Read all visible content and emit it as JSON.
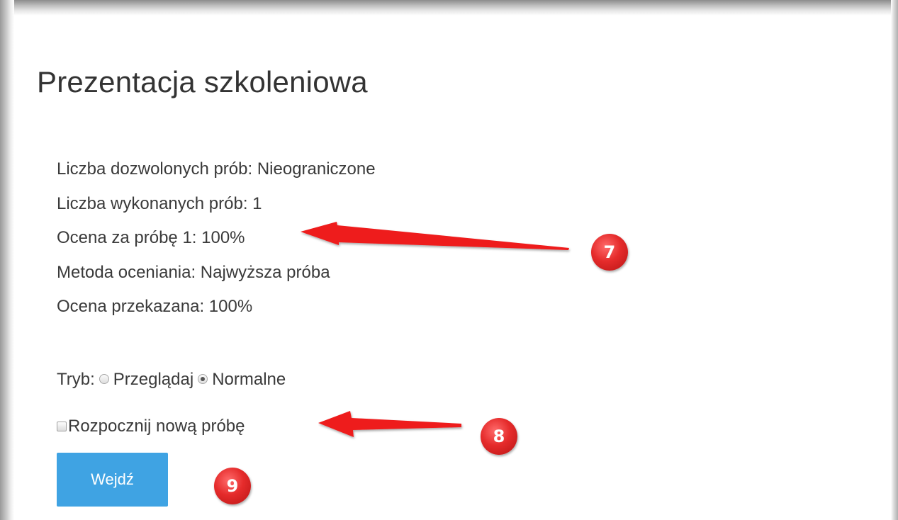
{
  "page": {
    "title": "Prezentacja szkoleniowa"
  },
  "attempts": {
    "allowed": "Liczba dozwolonych prób: Nieograniczone",
    "completed": "Liczba wykonanych prób: 1",
    "grade_attempt_1": "Ocena za próbę 1: 100%",
    "grading_method": "Metoda oceniania: Najwyższa próba",
    "grade_reported": "Ocena przekazana: 100%"
  },
  "mode": {
    "label": "Tryb:",
    "options": [
      "Przeglądaj",
      "Normalne"
    ],
    "selected": "Normalne"
  },
  "new_attempt": {
    "label": "Rozpocznij nową próbę",
    "checked": false
  },
  "enter_button": {
    "label": "Wejdź",
    "color": "#3fa3e3"
  },
  "annotations": {
    "color": "#e52b2b",
    "badges": [
      "7",
      "8",
      "9"
    ]
  }
}
